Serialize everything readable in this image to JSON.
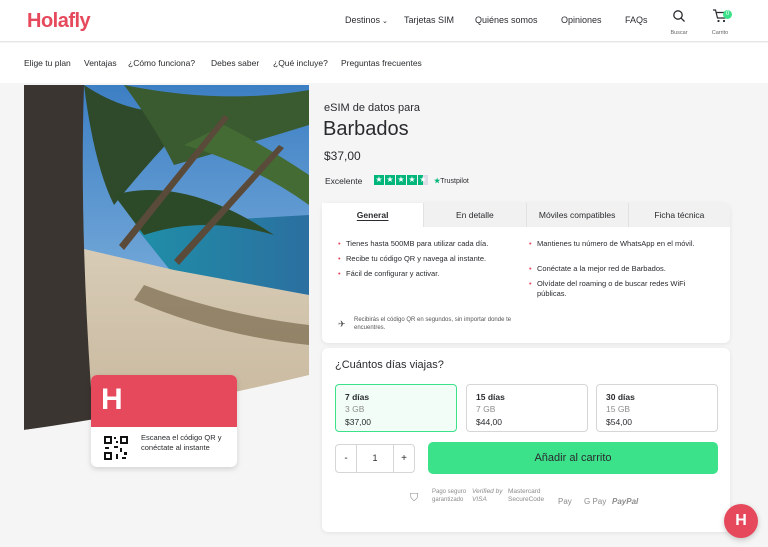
{
  "brand": {
    "logo": "Holafly",
    "accent": "#e6485c",
    "green": "#3ce28a"
  },
  "header": {
    "nav": [
      "Destinos",
      "Tarjetas SIM",
      "Quiénes somos",
      "Opiniones",
      "FAQs"
    ],
    "search_label": "Buscar",
    "cart_label": "Carrito",
    "cart_count": "0"
  },
  "subnav": [
    "Elige tu plan",
    "Ventajas",
    "¿Cómo funciona?",
    "Debes saber",
    "¿Qué incluye?",
    "Preguntas frecuentes"
  ],
  "qr_card": {
    "text": "Escanea el código QR y conéctate al instante"
  },
  "product": {
    "subtitle": "eSIM de datos para",
    "title": "Barbados",
    "price": "$37,00",
    "rating_label": "Excelente",
    "trustpilot": "Trustpilot"
  },
  "tabs": [
    "General",
    "En detalle",
    "Móviles compatibles",
    "Ficha técnica"
  ],
  "features_left": [
    "Tienes hasta 500MB para utilizar cada día.",
    "Recibe tu código QR y navega al instante.",
    "Fácil de configurar y activar."
  ],
  "features_right": [
    "Mantienes tu número de WhatsApp en el móvil.",
    "Conéctate a la mejor red de Barbados.",
    "Olvídate del roaming o de buscar redes WiFi públicas."
  ],
  "note": "Recibirás el código QR en segundos, sin importar donde te encuentres.",
  "days": {
    "question": "¿Cuántos días viajas?",
    "plans": [
      {
        "days": "7 días",
        "data": "3 GB",
        "price": "$37,00"
      },
      {
        "days": "15 días",
        "data": "7 GB",
        "price": "$44,00"
      },
      {
        "days": "30 días",
        "data": "15 GB",
        "price": "$54,00"
      }
    ],
    "quantity": "1",
    "minus": "-",
    "plus": "+",
    "add_to_cart": "Añadir al carrito"
  },
  "payments": {
    "secure": "Pago seguro garantizado",
    "visa": "Verified by VISA",
    "mastercard": "Mastercard SecureCode",
    "apple": " Pay",
    "google": "G Pay",
    "paypal": "PayPal"
  },
  "icons": {
    "search": "search-icon",
    "cart": "cart-icon",
    "chat": "holafly-chat-icon",
    "plane": "plane-icon"
  }
}
